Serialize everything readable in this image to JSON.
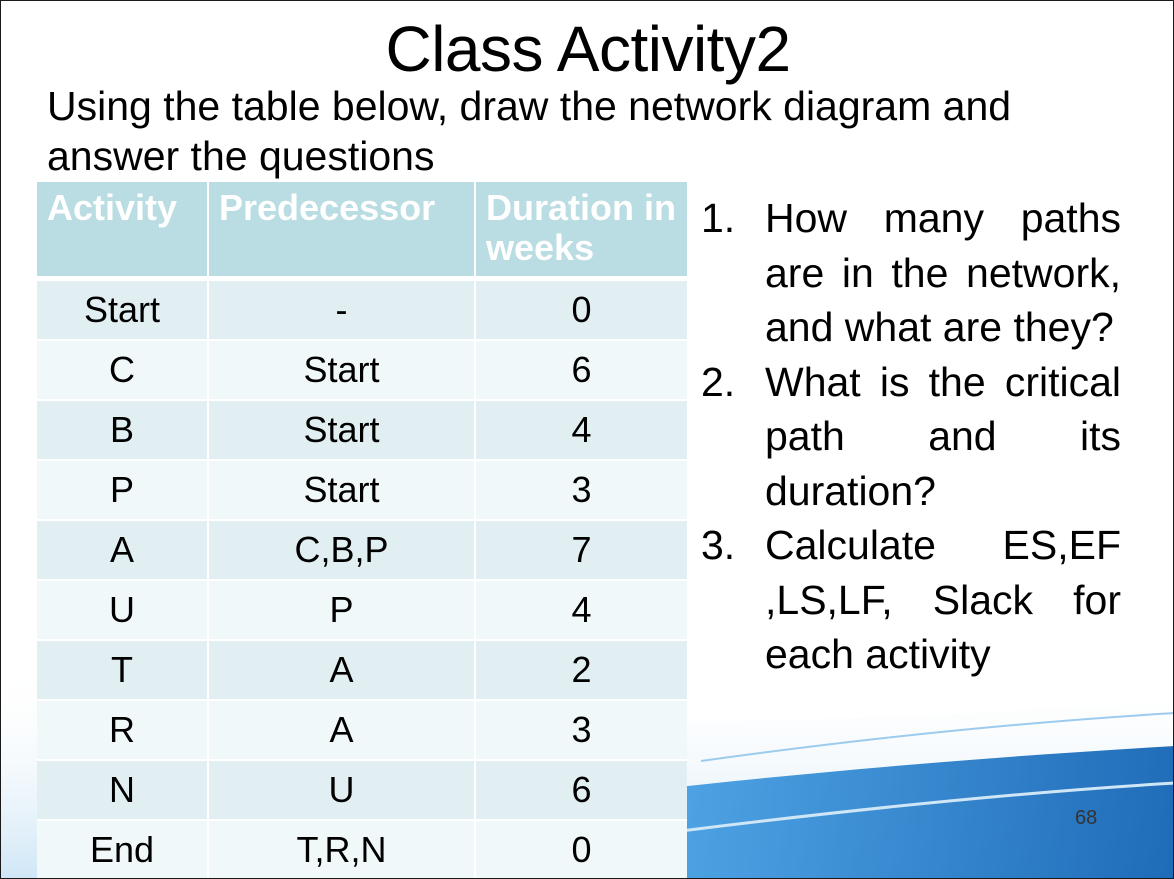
{
  "slide": {
    "title": "Class Activity2",
    "instructions": "Using the table below, draw the network diagram and answer the questions",
    "page_number": "68"
  },
  "table": {
    "headers": [
      "Activity",
      "Predecessor",
      "Duration in weeks"
    ],
    "rows": [
      [
        "Start",
        "-",
        "0"
      ],
      [
        "C",
        "Start",
        "6"
      ],
      [
        "B",
        "Start",
        "4"
      ],
      [
        "P",
        "Start",
        "3"
      ],
      [
        "A",
        "C,B,P",
        "7"
      ],
      [
        "U",
        "P",
        "4"
      ],
      [
        "T",
        "A",
        "2"
      ],
      [
        "R",
        "A",
        "3"
      ],
      [
        "N",
        "U",
        "6"
      ],
      [
        "End",
        "T,R,N",
        "0"
      ]
    ]
  },
  "questions": [
    {
      "number": "1.",
      "text": "How many paths are in the network, and what are they?"
    },
    {
      "number": "2.",
      "text": "What is the critical path and its duration?"
    },
    {
      "number": "3.",
      "text": "Calculate ES,EF ,LS,LF, Slack for each activity"
    }
  ],
  "colors": {
    "header_bg": "#b9dde2",
    "row_odd_bg": "#e2eff2",
    "row_even_bg": "#f1f8fa",
    "wave_blue": "#1f78c8"
  }
}
